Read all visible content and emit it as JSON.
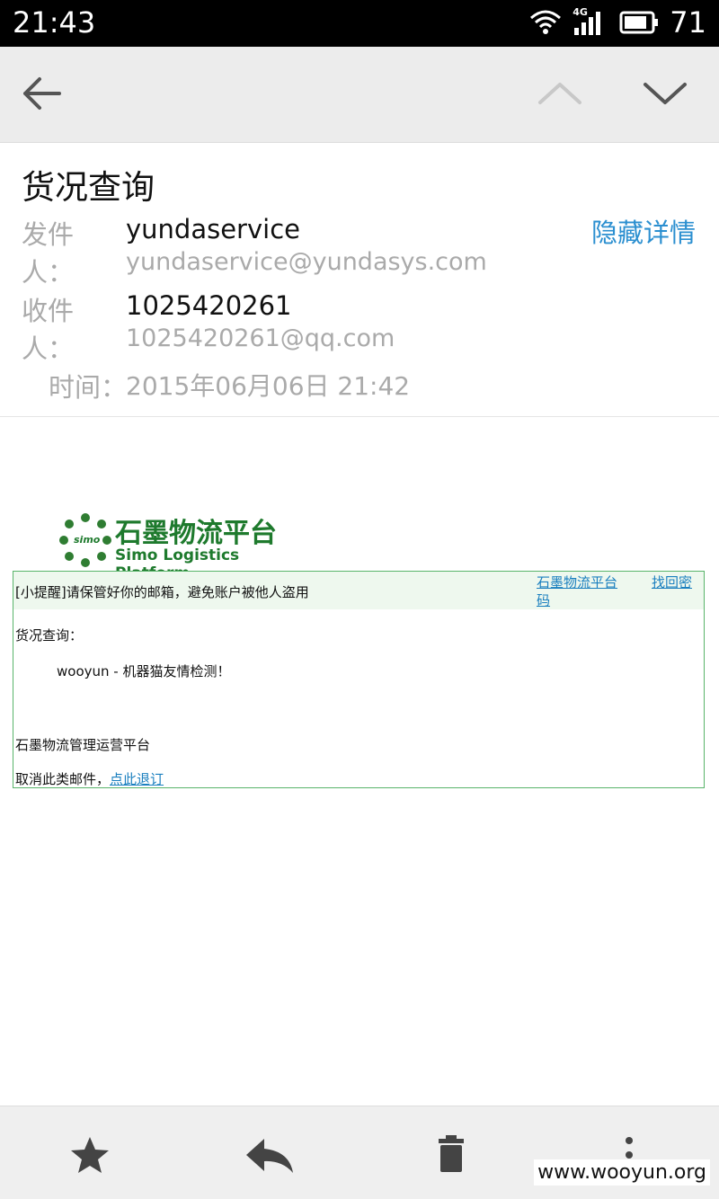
{
  "status_bar": {
    "time": "21:43",
    "network": "4G",
    "battery": "71"
  },
  "email": {
    "subject": "货况查询",
    "hide_details_label": "隐藏详情",
    "sender_label": "发件人：",
    "sender_name": "yundaservice",
    "sender_email": "yundaservice@yundasys.com",
    "recipient_label": "收件人：",
    "recipient_name": "1025420261",
    "recipient_email": "1025420261@qq.com",
    "time_label": "时间：",
    "time_value": "2015年06月06日 21:42"
  },
  "body": {
    "logo_cn": "石墨物流平台",
    "logo_en": "Simo Logistics Platform",
    "logo_small": "simo",
    "tip": "[小提醒]请保管好你的邮箱，避免账户被他人盗用",
    "link_platform": "石墨物流平台码",
    "link_platform_line1": "石墨物流平台",
    "link_platform_line2": "码",
    "link_recover": "找回密",
    "heading": "货况查询：",
    "message": "wooyun - 机器猫友情检测！",
    "signature": "石墨物流管理运营平台",
    "unsubscribe_prefix": "取消此类邮件，",
    "unsubscribe_link": "点此退订"
  },
  "watermark": "www.wooyun.org",
  "colors": {
    "accent": "#2b8fd0",
    "brand_green": "#1e7a2d",
    "border_green": "#59b46a"
  },
  "icons": [
    "back-arrow-icon",
    "chevron-up-icon",
    "chevron-down-icon",
    "star-icon",
    "reply-icon",
    "trash-icon",
    "more-vertical-icon"
  ]
}
